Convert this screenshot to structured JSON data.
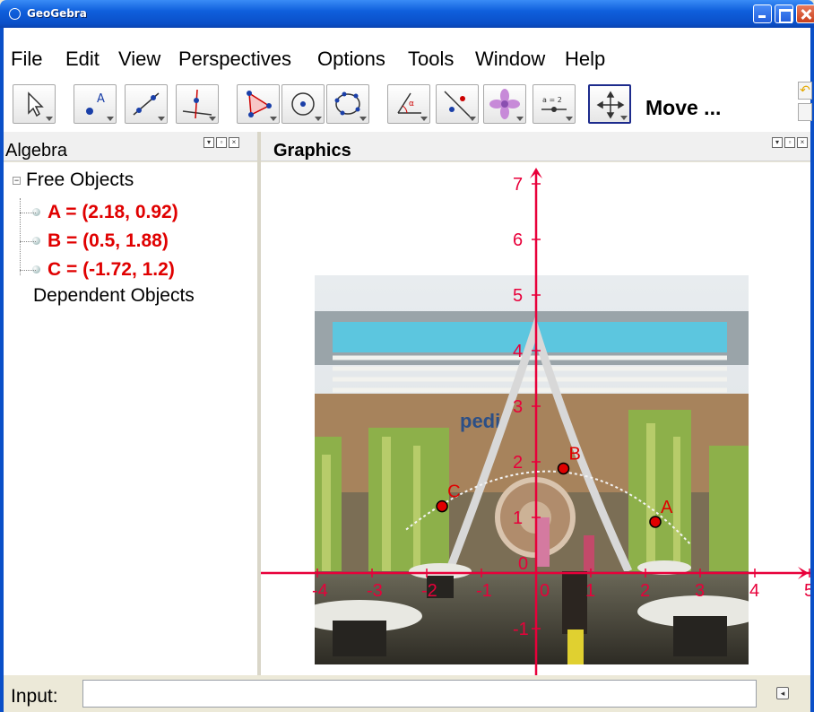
{
  "window": {
    "title": "GeoGebra"
  },
  "menu": [
    "File",
    "Edit",
    "View",
    "Perspectives",
    "Options",
    "Tools",
    "Window",
    "Help"
  ],
  "toolbar": {
    "tools": [
      "move-icon",
      "point-icon",
      "line-icon",
      "perpendicular-line-icon",
      "polygon-icon",
      "circle-icon",
      "conic-icon",
      "angle-icon",
      "reflect-icon",
      "flower-icon",
      "slider-icon",
      "move-graphics-icon"
    ],
    "slider_label": "a = 2",
    "mode_label": "Move ..."
  },
  "algebra": {
    "title": "Algebra",
    "free_label": "Free Objects",
    "objects": [
      {
        "text": "A = (2.18, 0.92)"
      },
      {
        "text": "B = (0.5, 1.88)"
      },
      {
        "text": "C = (-1.72, 1.2)"
      }
    ],
    "dependent_label": "Dependent Objects"
  },
  "graphics": {
    "title": "Graphics",
    "x_ticks": [
      -4,
      -3,
      -2,
      -1,
      0,
      1,
      2,
      3,
      4,
      5
    ],
    "y_ticks": [
      -1,
      0,
      1,
      2,
      3,
      4,
      5,
      6,
      7
    ],
    "axis_color": "#e8003a",
    "point_color": "#e00000",
    "points": [
      {
        "label": "A",
        "x": 2.18,
        "y": 0.92
      },
      {
        "label": "B",
        "x": 0.5,
        "y": 1.88
      },
      {
        "label": "C",
        "x": -1.72,
        "y": 1.2
      }
    ]
  },
  "input": {
    "label": "Input:",
    "value": ""
  }
}
